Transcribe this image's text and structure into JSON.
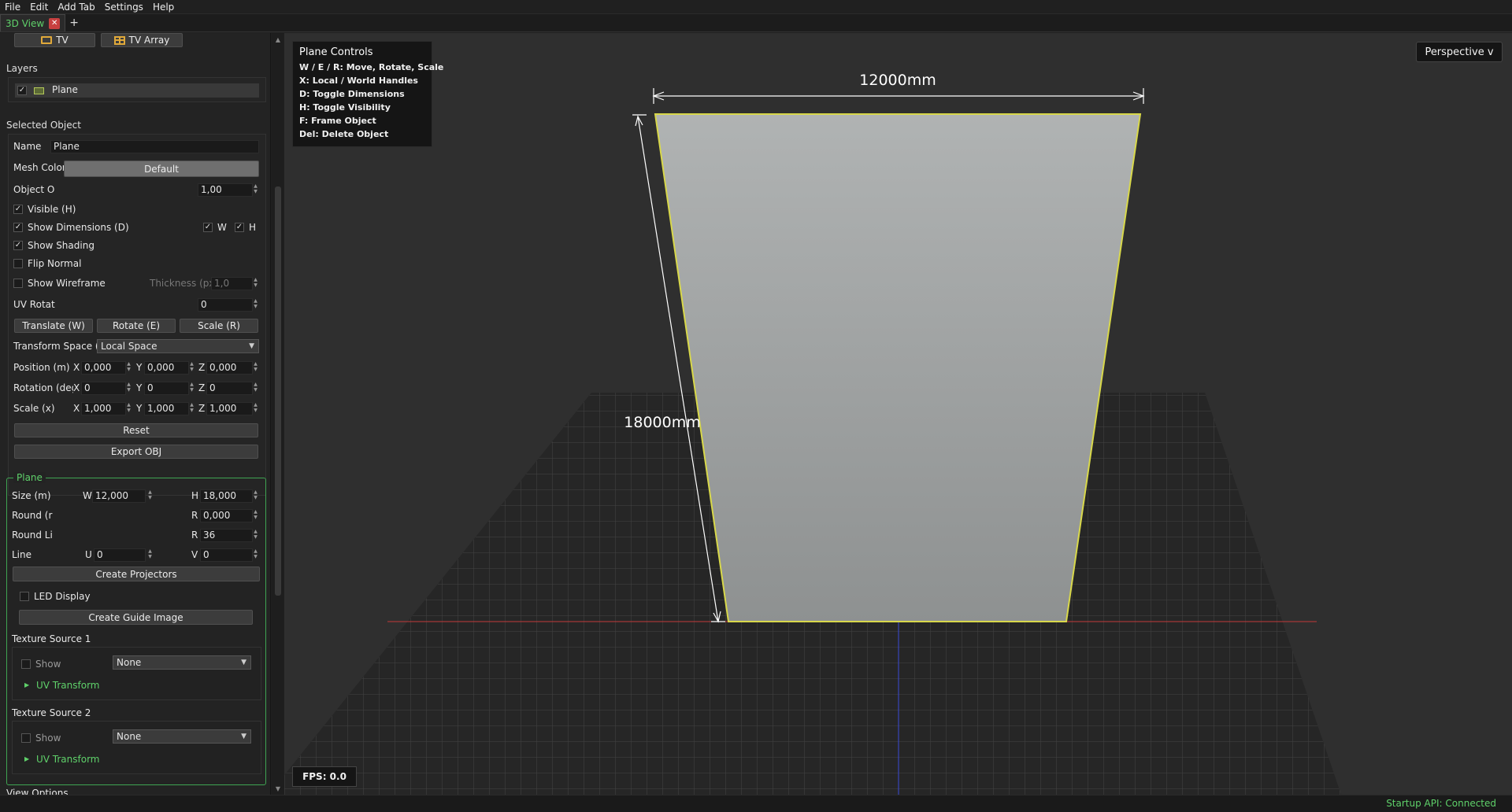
{
  "menu": [
    "File",
    "Edit",
    "Add Tab",
    "Settings",
    "Help"
  ],
  "tabs": {
    "active": "3D View",
    "add": "+"
  },
  "top_buttons": {
    "tv": "TV",
    "tv_array": "TV Array"
  },
  "layers": {
    "title": "Layers",
    "items": [
      {
        "label": "Plane",
        "checked": true
      }
    ]
  },
  "selected": {
    "title": "Selected Object",
    "name_label": "Name",
    "name_value": "Plane",
    "mesh_color_label": "Mesh Color",
    "mesh_color_value": "Default",
    "opacity_label": "Object O",
    "opacity_value": "1,00",
    "visible_label": "Visible (H)",
    "show_dims_label": "Show Dimensions (D)",
    "w_label": "W",
    "h_label": "H",
    "shading_label": "Show Shading",
    "flip_label": "Flip Normal",
    "wireframe_label": "Show Wireframe",
    "thickness_label": "Thickness (px)",
    "thickness_value": "1,0",
    "uv_rot_label": "UV Rotat",
    "uv_rot_value": "0",
    "translate_btn": "Translate (W)",
    "rotate_btn": "Rotate (E)",
    "scale_btn": "Scale (R)",
    "transform_space_label": "Transform Space (X)",
    "transform_space_value": "Local Space",
    "position_label": "Position (m)",
    "rotation_label": "Rotation (deg)",
    "scale_label": "Scale (x)",
    "axis_x": "X",
    "axis_y": "Y",
    "axis_z": "Z",
    "pos": {
      "x": "0,000",
      "y": "0,000",
      "z": "0,000"
    },
    "rot": {
      "x": "0",
      "y": "0",
      "z": "0"
    },
    "scl": {
      "x": "1,000",
      "y": "1,000",
      "z": "1,000"
    },
    "reset_btn": "Reset",
    "export_btn": "Export OBJ"
  },
  "plane": {
    "title": "Plane",
    "size_label": "Size (m)",
    "w_label": "W",
    "w_value": "12,000",
    "h_label": "H",
    "h_value": "18,000",
    "round1_label": "Round (r",
    "r1_label": "R",
    "r1_value": "0,000",
    "round2_label": "Round Li",
    "r2_label": "R",
    "r2_value": "36",
    "line_label": "Line",
    "u_label": "U",
    "u_value": "0",
    "v_label": "V",
    "v_value": "0",
    "create_projectors": "Create Projectors",
    "led_display": "LED Display",
    "create_guide": "Create Guide Image",
    "tex1_title": "Texture Source 1",
    "tex2_title": "Texture Source 2",
    "show_label": "Show",
    "source_value": "None",
    "uv_transform": "UV Transform"
  },
  "view_options": "View Options",
  "viewport": {
    "controls_title": "Plane Controls",
    "controls": [
      "W / E / R: Move, Rotate, Scale",
      "X: Local / World Handles",
      "D: Toggle Dimensions",
      "H: Toggle Visibility",
      "F: Frame Object",
      "Del: Delete Object"
    ],
    "perspective": "Perspective v",
    "fps": "FPS: 0.0",
    "dim_width": "12000mm",
    "dim_height": "18000mm"
  },
  "status": "Startup API: Connected",
  "colors": {
    "accent": "#5fd16a",
    "outline": "#d8d84a",
    "plane_top": "#b0b3b3",
    "plane_bottom": "#8e9191"
  }
}
